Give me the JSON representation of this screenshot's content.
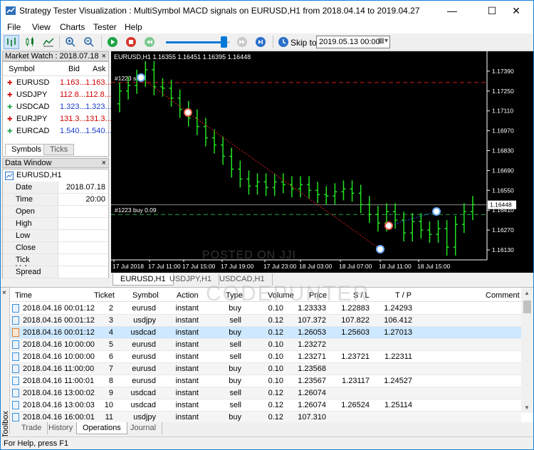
{
  "window": {
    "title": "Strategy Tester Visualization : MultiSymbol MACD signals on EURUSD,H1 from 2018.04.14 to 2019.04.27",
    "minimize": "—",
    "maximize": "☐",
    "close": "✕"
  },
  "menu": [
    "File",
    "View",
    "Charts",
    "Tester",
    "Help"
  ],
  "toolbar": {
    "skip_to_label": "Skip to",
    "skip_date": "2019.05.13 00:00",
    "slider_fraction": 0.85
  },
  "market_watch": {
    "title": "Market Watch : 2018.07.18",
    "headers": {
      "symbol": "Symbol",
      "bid": "Bid",
      "ask": "Ask"
    },
    "rows": [
      {
        "symbol": "EURUSD",
        "bid": "1.163...",
        "ask": "1.163...",
        "dir": "down",
        "color": "#d40000"
      },
      {
        "symbol": "USDJPY",
        "bid": "112.8...",
        "ask": "112.8...",
        "dir": "down",
        "color": "#d40000"
      },
      {
        "symbol": "USDCAD",
        "bid": "1.323...",
        "ask": "1.323...",
        "dir": "up",
        "color": "#1a3cc8"
      },
      {
        "symbol": "EURJPY",
        "bid": "131.3...",
        "ask": "131.3...",
        "dir": "down",
        "color": "#d40000"
      },
      {
        "symbol": "EURCAD",
        "bid": "1.540...",
        "ask": "1.540...",
        "dir": "up",
        "color": "#1a3cc8"
      }
    ],
    "tabs": [
      "Symbols",
      "Ticks"
    ]
  },
  "data_window": {
    "title": "Data Window",
    "symbol": "EURUSD,H1",
    "rows": [
      {
        "k": "Date",
        "v": "2018.07.18"
      },
      {
        "k": "Time",
        "v": "20:00"
      },
      {
        "k": "Open",
        "v": ""
      },
      {
        "k": "High",
        "v": ""
      },
      {
        "k": "Low",
        "v": ""
      },
      {
        "k": "Close",
        "v": ""
      },
      {
        "k": "Tick Volume",
        "v": ""
      },
      {
        "k": "Spread",
        "v": ""
      }
    ]
  },
  "chart": {
    "header": "EURUSD,H1  1.16355 1.16451 1.16395 1.16448",
    "order_label_1": "#1223 sl",
    "order_label_2": "#1223 buy 0.09",
    "price_labels": [
      "1.17390",
      "1.17250",
      "1.17110",
      "1.16970",
      "1.16830",
      "1.16690",
      "1.16550",
      "1.16410",
      "1.16270",
      "1.16130"
    ],
    "current_price": "1.16448",
    "time_labels": [
      "17 Jul 2018",
      "17 Jul 11:00",
      "17 Jul 15:00",
      "17 Jul 19:00",
      "17 Jul 23:00",
      "18 Jul 03:00",
      "18 Jul 07:00",
      "18 Jul 11:00",
      "18 Jul 15:00"
    ],
    "tabs": [
      "EURUSD,H1",
      "USDJPY,H1",
      "USDCAD,H1"
    ]
  },
  "toolbox": {
    "label": "Toolbox",
    "headers": [
      "Time",
      "Ticket",
      "Symbol",
      "Action",
      "Type",
      "Volume",
      "Price",
      "S / L",
      "T / P",
      "Comment"
    ],
    "rows": [
      [
        "2018.04.16 00:01:12",
        "2",
        "eurusd",
        "instant",
        "buy",
        "0.10",
        "1.23333",
        "1.22883",
        "1.24293",
        ""
      ],
      [
        "2018.04.16 00:01:12",
        "3",
        "usdjpy",
        "instant",
        "sell",
        "0.12",
        "107.372",
        "107.822",
        "106.412",
        ""
      ],
      [
        "2018.04.16 00:01:12",
        "4",
        "usdcad",
        "instant",
        "buy",
        "0.12",
        "1.26053",
        "1.25603",
        "1.27013",
        ""
      ],
      [
        "2018.04.16 10:00:00",
        "5",
        "eurusd",
        "instant",
        "sell",
        "0.10",
        "1.23272",
        "",
        "",
        ""
      ],
      [
        "2018.04.16 10:00:00",
        "6",
        "eurusd",
        "instant",
        "sell",
        "0.10",
        "1.23271",
        "1.23721",
        "1.22311",
        ""
      ],
      [
        "2018.04.16 11:00:00",
        "7",
        "eurusd",
        "instant",
        "buy",
        "0.10",
        "1.23568",
        "",
        "",
        ""
      ],
      [
        "2018.04.16 11:00:01",
        "8",
        "eurusd",
        "instant",
        "buy",
        "0.10",
        "1.23567",
        "1.23117",
        "1.24527",
        ""
      ],
      [
        "2018.04.16 13:00:02",
        "9",
        "usdcad",
        "instant",
        "sell",
        "0.12",
        "1.26074",
        "",
        "",
        ""
      ],
      [
        "2018.04.16 13:00:03",
        "10",
        "usdcad",
        "instant",
        "sell",
        "0.12",
        "1.26074",
        "1.26524",
        "1.25114",
        ""
      ],
      [
        "2018.04.16 16:00:01",
        "11",
        "usdjpy",
        "instant",
        "buy",
        "0.12",
        "107.310",
        "",
        "",
        ""
      ]
    ],
    "tabs": [
      "Trade",
      "History",
      "Operations",
      "Journal"
    ]
  },
  "status": "For Help, press F1",
  "watermarks": [
    "POSTED ON JJI",
    "CODEPUNTER"
  ]
}
